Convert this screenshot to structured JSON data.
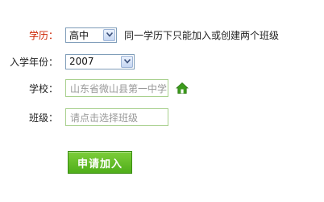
{
  "form": {
    "education": {
      "label": "学历：",
      "selected": "高中",
      "hint": "同一学历下只能加入或创建两个班级"
    },
    "enroll_year": {
      "label": "入学年份：",
      "selected": "2007"
    },
    "school": {
      "label": "学校：",
      "value": "山东省微山县第一中学",
      "icon": "home-icon"
    },
    "class": {
      "label": "班级：",
      "placeholder": "请点击选择班级"
    },
    "submit_label": "申请加入"
  },
  "colors": {
    "required_label": "#cc2200",
    "input_border": "#a8d08d",
    "button_green": "#4fae1a",
    "home_icon": "#3c9b1c"
  }
}
